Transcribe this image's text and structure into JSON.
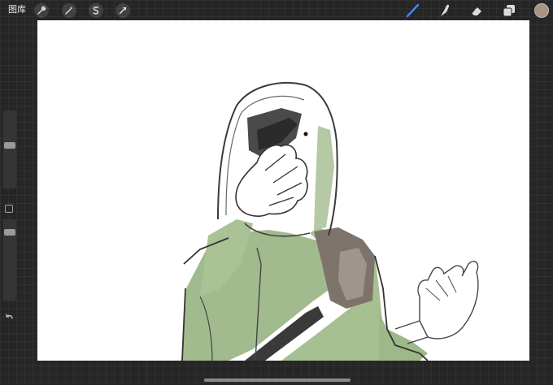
{
  "topbar": {
    "gallery_label": "图库",
    "left_tools": [
      {
        "name": "wrench-icon"
      },
      {
        "name": "magic-wand-icon"
      },
      {
        "name": "selection-icon"
      },
      {
        "name": "transform-arrow-icon"
      }
    ],
    "right_tools": [
      {
        "name": "brush-icon",
        "active": true
      },
      {
        "name": "smudge-icon"
      },
      {
        "name": "eraser-icon"
      },
      {
        "name": "layers-icon"
      }
    ],
    "current_color": "#a89482"
  },
  "colors": {
    "active_tool": "#3d8bff",
    "inactive_tool": "#dcdcdc",
    "canvas": "#ffffff",
    "green": "#9db889",
    "brown": "#7e736b"
  }
}
